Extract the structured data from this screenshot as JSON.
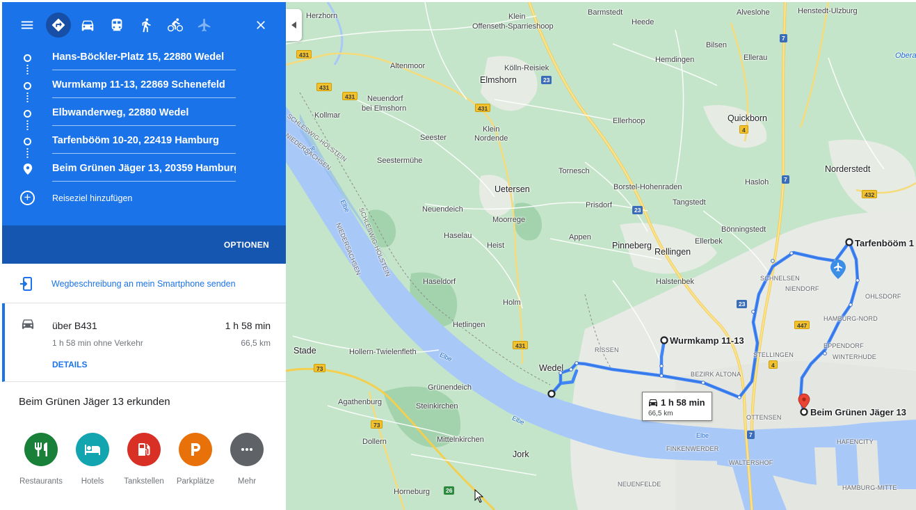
{
  "panel": {
    "modes": [
      {
        "name": "best-route",
        "icon": "directions-icon"
      },
      {
        "name": "driving",
        "icon": "car-icon"
      },
      {
        "name": "transit",
        "icon": "train-icon"
      },
      {
        "name": "walking",
        "icon": "walk-icon"
      },
      {
        "name": "cycling",
        "icon": "bike-icon"
      },
      {
        "name": "flight",
        "icon": "airplane-icon"
      }
    ],
    "waypoints": [
      "Hans-Böckler-Platz 15, 22880 Wedel",
      "Wurmkamp 11-13, 22869 Schenefeld",
      "Elbwanderweg, 22880 Wedel",
      "Tarfenbööm 10-20, 22419 Hamburg",
      "Beim Grünen Jäger 13, 20359 Hamburg"
    ],
    "add_destination": "Reiseziel hinzufügen",
    "options": "OPTIONEN",
    "send_to_phone": "Wegbeschreibung an mein Smartphone senden",
    "route": {
      "via": "über B431",
      "time": "1 h 58 min",
      "subtitle": "1 h 58 min ohne Verkehr",
      "distance": "66,5 km",
      "details": "DETAILS"
    },
    "explore_title": "Beim Grünen Jäger 13 erkunden",
    "poi": [
      {
        "label": "Restaurants",
        "color": "#188038",
        "icon": "restaurant-icon"
      },
      {
        "label": "Hotels",
        "color": "#12a4af",
        "icon": "hotel-icon"
      },
      {
        "label": "Tankstellen",
        "color": "#d93025",
        "icon": "gas-station-icon"
      },
      {
        "label": "Parkplätze",
        "color": "#e8710a",
        "icon": "parking-icon"
      },
      {
        "label": "Mehr",
        "color": "#5f6368",
        "icon": "more-icon"
      }
    ]
  },
  "map": {
    "places": {
      "herzhorn": "Herzhorn",
      "klein_offensheim": "Klein",
      "offensheim2": "Offenseth-Sparrieshoop",
      "barmstedt": "Barmstedt",
      "heede": "Heede",
      "alveslohe": "Alveslohe",
      "henstedt": "Henstedt-Ulzburg",
      "bilsen": "Bilsen",
      "oberalster": "Oberals",
      "altenmoor": "Altenmoor",
      "koelln": "Kölln-Reisiek",
      "hemdingen": "Hemdingen",
      "ellerau": "Ellerau",
      "elmshorn": "Elmshorn",
      "neuendorf": "Neuendorf",
      "bei_elmshorn": "bei Elmshorn",
      "kollmar": "Kollmar",
      "ellerhoop": "Ellerhoop",
      "quickborn": "Quickborn",
      "klein_nordende1": "Klein",
      "klein_nordende2": "Nordende",
      "seester": "Seester",
      "seestermuehe": "Seestermühe",
      "tornesch": "Tornesch",
      "norderstedt": "Norderstedt",
      "hasloh": "Hasloh",
      "uetersen": "Uetersen",
      "borstel": "Borstel-Hohenraden",
      "prisdorf": "Prisdorf",
      "tangstedt": "Tangstedt",
      "neuendeich": "Neuendeich",
      "moorrege": "Moorrege",
      "boenningstedt": "Bönningstedt",
      "haselau": "Haselau",
      "heist": "Heist",
      "appen": "Appen",
      "pinneberg": "Pinneberg",
      "rellingen": "Rellingen",
      "ellerbek": "Ellerbek",
      "haseldorf": "Haseldorf",
      "halstenbek": "Halstenbek",
      "schnelsen": "SCHNELSEN",
      "niendorf": "NIENDORF",
      "ohlsdorf": "OHLSDORF",
      "holm": "Holm",
      "hetlingen": "Hetlingen",
      "hamburg_nord": "HAMBURG-NORD",
      "rissen": "RISSEN",
      "eppendorf": "EPPENDORF",
      "stade": "Stade",
      "hollern": "Hollern-Twielenfleth",
      "wedel": "Wedel",
      "stellingen": "STELLINGEN",
      "winterhude": "WINTERHUDE",
      "bezirk_altona": "BEZIRK ALTONA",
      "gruenendeich": "Grünendeich",
      "agathenburg": "Agathenburg",
      "steinkirchen": "Steinkirchen",
      "ottensen": "OTTENSEN",
      "hafencity": "HAFENCITY",
      "dollern": "Dollern",
      "mittelnkirchen": "Mittelnkirchen",
      "finkenwerder": "FINKENWERDER",
      "jork": "Jork",
      "waltershof": "WALTERSHOF",
      "neuenfelde": "NEUENFELDE",
      "horneburg": "Horneburg",
      "hamburg_mitte": "HAMBURG-MITTE",
      "elbe1": "Elbe",
      "elbe2": "Elbe",
      "elbe3": "Elbe",
      "elbe4": "Elbe",
      "sh1": "SCHLESWIG-HOLSTEIN",
      "nds1": "NIEDERSACHSEN",
      "sh2": "SCHLESWIG-HOLSTEIN",
      "nds2": "NIEDERSACHSEN"
    },
    "shields": {
      "s431a": "431",
      "s431b": "431",
      "s431c": "431",
      "s431d": "431",
      "s431e": "431",
      "s23a": "23",
      "s23b": "23",
      "s23c": "23",
      "s7a": "7",
      "s7b": "7",
      "s7c": "7",
      "s4a": "4",
      "s4b": "4",
      "s432": "432",
      "s447": "447",
      "s73a": "73",
      "s73b": "73",
      "s26": "26"
    },
    "waypoint_labels": {
      "tarfenboeoem": "Tarfenbööm 1",
      "wurmkamp": "Wurmkamp 11-13",
      "gruener_jaeger": "Beim Grünen Jäger 13"
    },
    "route_box": {
      "time": "1 h 58 min",
      "distance": "66,5 km"
    },
    "colors": {
      "route": "#4285f4",
      "water": "#a8c8f8",
      "land": "#b5dcbd",
      "urban": "#e8eae6",
      "road_major": "#f7d774"
    }
  }
}
